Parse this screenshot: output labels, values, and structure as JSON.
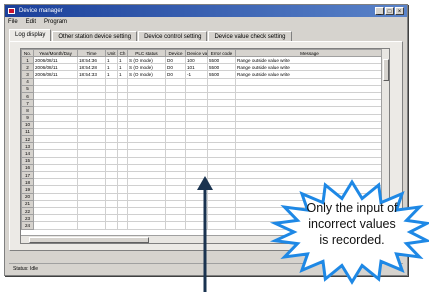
{
  "window": {
    "title": "Device manager",
    "menu": [
      "File",
      "Edit",
      "Program"
    ],
    "controls": [
      "_",
      "□",
      "×"
    ]
  },
  "tabs": [
    "Log display",
    "Other station device setting",
    "Device control setting",
    "Device value check setting"
  ],
  "table": {
    "columns": [
      "No.",
      "Year/Month/Day",
      "Time",
      "Unit",
      "Ch",
      "PLC status",
      "Device",
      "Device value",
      "Error code",
      "Message"
    ],
    "rows": [
      [
        "1",
        "2006/08/11",
        "18:54:36",
        "1",
        "1",
        "S (O mode)",
        "D0",
        "100",
        "5500",
        "Range outside value write"
      ],
      [
        "2",
        "2006/08/11",
        "18:54:28",
        "1",
        "1",
        "S (O mode)",
        "D0",
        "101",
        "5500",
        "Range outside value write"
      ],
      [
        "3",
        "2006/08/11",
        "18:54:33",
        "1",
        "1",
        "S (O mode)",
        "D0",
        "-1",
        "5500",
        "Range outside value write"
      ],
      [
        "4"
      ],
      [
        "5"
      ],
      [
        "6"
      ],
      [
        "7"
      ],
      [
        "8"
      ],
      [
        "9"
      ],
      [
        "10"
      ],
      [
        "11"
      ],
      [
        "12"
      ],
      [
        "13"
      ],
      [
        "14"
      ],
      [
        "15"
      ],
      [
        "16"
      ],
      [
        "17"
      ],
      [
        "18"
      ],
      [
        "19"
      ],
      [
        "20"
      ],
      [
        "21"
      ],
      [
        "22"
      ],
      [
        "23"
      ],
      [
        "24"
      ]
    ]
  },
  "statusbar": {
    "text": "Status: Idle"
  },
  "callout": {
    "lines": [
      "Only the input of",
      "incorrect values",
      "is recorded."
    ],
    "fill": "#ffffff",
    "stroke": "#1e88e5"
  },
  "arrow_color": "#1a3350"
}
